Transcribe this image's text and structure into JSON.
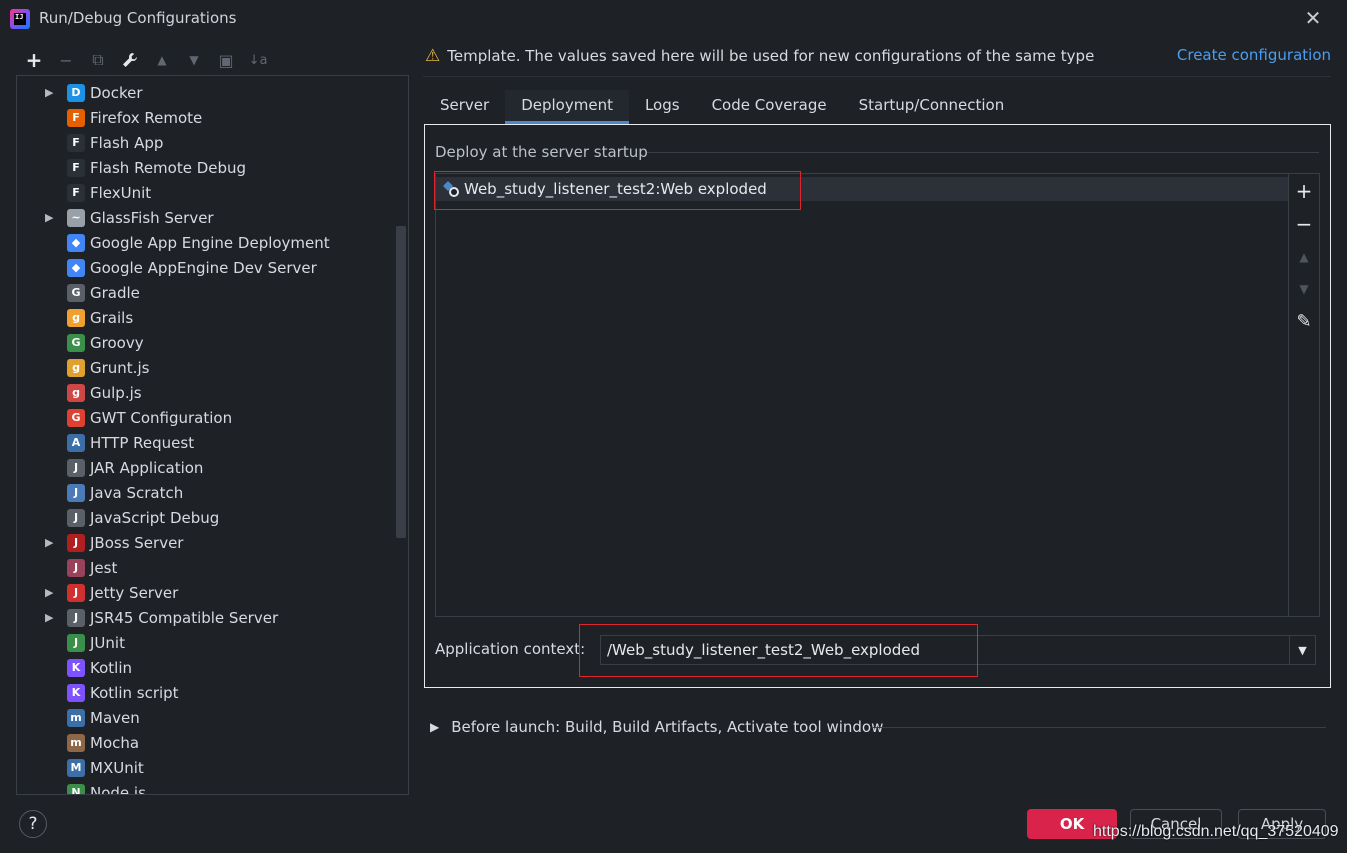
{
  "window": {
    "title": "Run/Debug Configurations",
    "logo_text": "IJ"
  },
  "toolbar": {
    "add": "+",
    "remove": "−",
    "copy": "⧉",
    "wrench": "🔧",
    "up": "▲",
    "down": "▼",
    "folder": "▣",
    "sort": "↓a"
  },
  "tree": {
    "items": [
      {
        "label": "Docker",
        "arrow": "▶",
        "icon": "D",
        "color": "#1d91e6"
      },
      {
        "label": "Firefox Remote",
        "arrow": "",
        "icon": "F",
        "color": "#e66000"
      },
      {
        "label": "Flash App",
        "arrow": "",
        "icon": "F",
        "color": "#2b2f36"
      },
      {
        "label": "Flash Remote Debug",
        "arrow": "",
        "icon": "F",
        "color": "#2b2f36"
      },
      {
        "label": "FlexUnit",
        "arrow": "",
        "icon": "F",
        "color": "#2b2f36"
      },
      {
        "label": "GlassFish Server",
        "arrow": "▶",
        "icon": "~",
        "color": "#9aa0a8"
      },
      {
        "label": "Google App Engine Deployment",
        "arrow": "",
        "icon": "◆",
        "color": "#4285f4"
      },
      {
        "label": "Google AppEngine Dev Server",
        "arrow": "",
        "icon": "◆",
        "color": "#4285f4"
      },
      {
        "label": "Gradle",
        "arrow": "",
        "icon": "G",
        "color": "#5b6068"
      },
      {
        "label": "Grails",
        "arrow": "",
        "icon": "g",
        "color": "#f0a030"
      },
      {
        "label": "Groovy",
        "arrow": "",
        "icon": "G",
        "color": "#3a8f4a"
      },
      {
        "label": "Grunt.js",
        "arrow": "",
        "icon": "g",
        "color": "#e0a030"
      },
      {
        "label": "Gulp.js",
        "arrow": "",
        "icon": "g",
        "color": "#cf4646"
      },
      {
        "label": "GWT Configuration",
        "arrow": "",
        "icon": "G",
        "color": "#de4032"
      },
      {
        "label": "HTTP Request",
        "arrow": "",
        "icon": "A",
        "color": "#3c6ea8"
      },
      {
        "label": "JAR Application",
        "arrow": "",
        "icon": "J",
        "color": "#5b6068"
      },
      {
        "label": "Java Scratch",
        "arrow": "",
        "icon": "J",
        "color": "#4a7ab8"
      },
      {
        "label": "JavaScript Debug",
        "arrow": "",
        "icon": "J",
        "color": "#5b6068"
      },
      {
        "label": "JBoss Server",
        "arrow": "▶",
        "icon": "J",
        "color": "#b02020"
      },
      {
        "label": "Jest",
        "arrow": "",
        "icon": "J",
        "color": "#99425b"
      },
      {
        "label": "Jetty Server",
        "arrow": "▶",
        "icon": "J",
        "color": "#d03030"
      },
      {
        "label": "JSR45 Compatible Server",
        "arrow": "▶",
        "icon": "J",
        "color": "#5b6068"
      },
      {
        "label": "JUnit",
        "arrow": "",
        "icon": "J",
        "color": "#3a8f4a"
      },
      {
        "label": "Kotlin",
        "arrow": "",
        "icon": "K",
        "color": "#7f52ff"
      },
      {
        "label": "Kotlin script",
        "arrow": "",
        "icon": "K",
        "color": "#7f52ff"
      },
      {
        "label": "Maven",
        "arrow": "",
        "icon": "m",
        "color": "#3c6ea8"
      },
      {
        "label": "Mocha",
        "arrow": "",
        "icon": "m",
        "color": "#8d6748"
      },
      {
        "label": "MXUnit",
        "arrow": "",
        "icon": "M",
        "color": "#3c6ea8"
      },
      {
        "label": "Node.js",
        "arrow": "",
        "icon": "N",
        "color": "#3a8f4a"
      }
    ]
  },
  "notice": {
    "icon": "⚠",
    "text": "Template. The values saved here will be used for new configurations of the same type",
    "link": "Create configuration"
  },
  "tabs": [
    {
      "label": "Server"
    },
    {
      "label": "Deployment"
    },
    {
      "label": "Logs"
    },
    {
      "label": "Code Coverage"
    },
    {
      "label": "Startup/Connection"
    }
  ],
  "deployment": {
    "section_title": "Deploy at the server startup",
    "artifact": "Web_study_listener_test2:Web exploded",
    "add": "+",
    "remove": "−",
    "up": "▲",
    "down": "▼",
    "edit": "✎",
    "context_label": "Application context:",
    "context_value": "/Web_study_listener_test2_Web_exploded",
    "dropdown": "▼"
  },
  "before_launch": {
    "arrow": "▶",
    "text": "Before launch: Build, Build Artifacts, Activate tool window"
  },
  "footer": {
    "help": "?",
    "ok": "OK",
    "cancel": "Cancel",
    "apply": "Apply",
    "watermark": "https://blog.csdn.net/qq_37520409"
  },
  "colors": {
    "accent": "#4a88c7",
    "ok_button": "#d9234b",
    "link": "#4b9ef0",
    "highlight_box": "#e0242c"
  }
}
